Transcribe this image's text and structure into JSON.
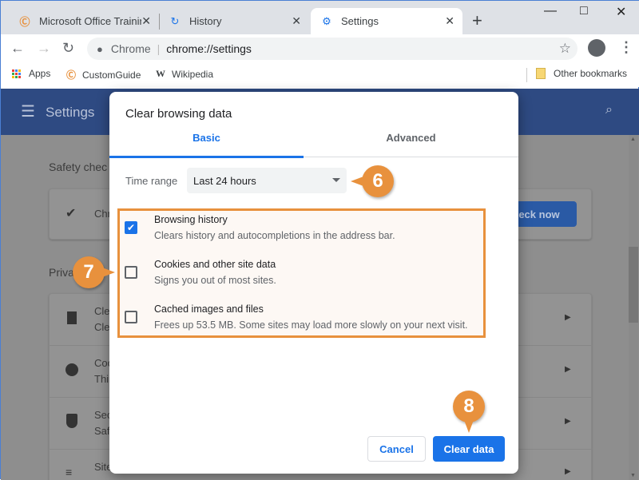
{
  "browser": {
    "tabs": [
      {
        "label": "Microsoft Office Training",
        "icon": "customguide-icon"
      },
      {
        "label": "History",
        "icon": "history-icon"
      },
      {
        "label": "Settings",
        "icon": "gear-icon",
        "active": true
      }
    ],
    "omnibox": {
      "site_label": "Chrome",
      "url": "chrome://settings"
    },
    "bookmarks": [
      {
        "label": "Apps",
        "icon": "apps-icon"
      },
      {
        "label": "CustomGuide",
        "icon": "customguide-icon"
      },
      {
        "label": "Wikipedia",
        "icon": "wikipedia-icon"
      }
    ],
    "other_bookmarks": "Other bookmarks"
  },
  "settings": {
    "header_title": "Settings",
    "safety_check_heading": "Safety chec",
    "safety_card_text": "Chr",
    "check_now_label": "Check now",
    "privacy_heading": "Priva",
    "rows": [
      {
        "title": "Clea",
        "sub": "Clea",
        "icon": "trash-icon"
      },
      {
        "title": "Coo",
        "sub": "Thir",
        "icon": "cookie-icon"
      },
      {
        "title": "Sec",
        "sub": "Saf",
        "icon": "shield-icon"
      },
      {
        "title": "Site",
        "sub": "",
        "icon": "sliders-icon"
      }
    ]
  },
  "dialog": {
    "title": "Clear browsing data",
    "tabs": [
      {
        "label": "Basic",
        "selected": true
      },
      {
        "label": "Advanced",
        "selected": false
      }
    ],
    "time_range_label": "Time range",
    "time_range_value": "Last 24 hours",
    "items": [
      {
        "title": "Browsing history",
        "subtitle": "Clears history and autocompletions in the address bar.",
        "checked": true
      },
      {
        "title": "Cookies and other site data",
        "subtitle": "Signs you out of most sites.",
        "checked": false
      },
      {
        "title": "Cached images and files",
        "subtitle": "Frees up 53.5 MB. Some sites may load more slowly on your next visit.",
        "checked": false
      }
    ],
    "cancel_label": "Cancel",
    "clear_label": "Clear data"
  },
  "callouts": [
    "6",
    "7",
    "8"
  ],
  "colors": {
    "accent": "#1a73e8",
    "callout": "#e8913d",
    "header": "#2e4a82"
  }
}
